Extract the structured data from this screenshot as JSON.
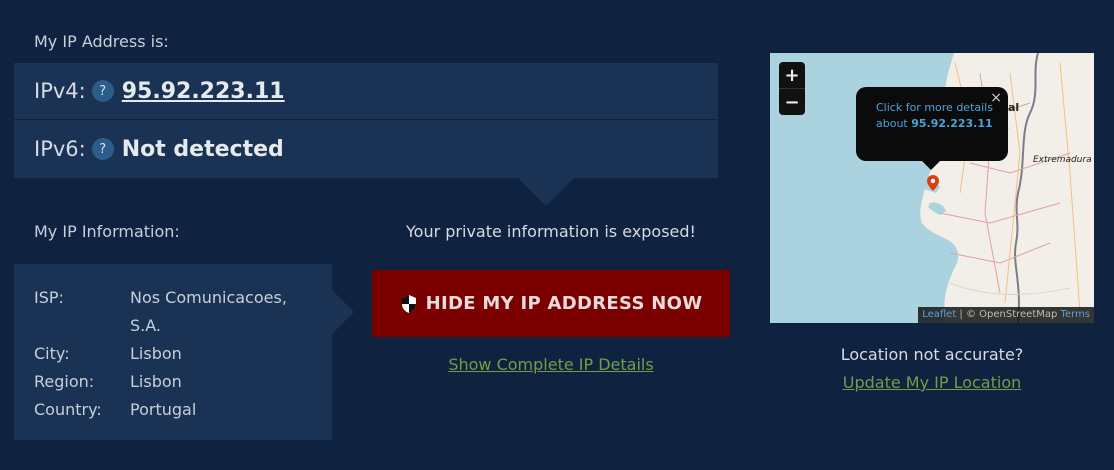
{
  "ip_section": {
    "heading": "My IP Address is:",
    "ipv4_label": "IPv4:",
    "ipv4_value": "95.92.223.11",
    "ipv6_label": "IPv6:",
    "ipv6_value": "Not detected",
    "help_glyph": "?"
  },
  "info_section": {
    "heading": "My IP Information:",
    "rows": [
      {
        "key": "ISP:",
        "value": "Nos Comunicacoes, S.A."
      },
      {
        "key": "City:",
        "value": "Lisbon"
      },
      {
        "key": "Region:",
        "value": "Lisbon"
      },
      {
        "key": "Country:",
        "value": "Portugal"
      }
    ]
  },
  "action": {
    "exposed_text": "Your private information is exposed!",
    "hide_button_label": "HIDE MY IP ADDRESS NOW",
    "details_link": "Show Complete IP Details"
  },
  "map": {
    "zoom_in": "+",
    "zoom_out": "−",
    "popup_line1": "Click for more details",
    "popup_about": "about",
    "popup_ip": "95.92.223.11",
    "popup_close": "×",
    "region_label": "Extremadura",
    "partial_label": "al",
    "attribution_leaflet": "Leaflet",
    "attribution_sep": " | © ",
    "attribution_osm": "OpenStreetMap",
    "attribution_terms": "Terms"
  },
  "location": {
    "question": "Location not accurate?",
    "update_link": "Update My IP Location"
  },
  "colors": {
    "background": "#0f2240",
    "panel": "#1a3355",
    "button": "#7a0000",
    "link_green": "#6f9e4a",
    "sea": "#aad3df",
    "land": "#f2efe9"
  },
  "icons": [
    "help-icon",
    "shield-icon",
    "map-marker-icon",
    "close-icon"
  ]
}
